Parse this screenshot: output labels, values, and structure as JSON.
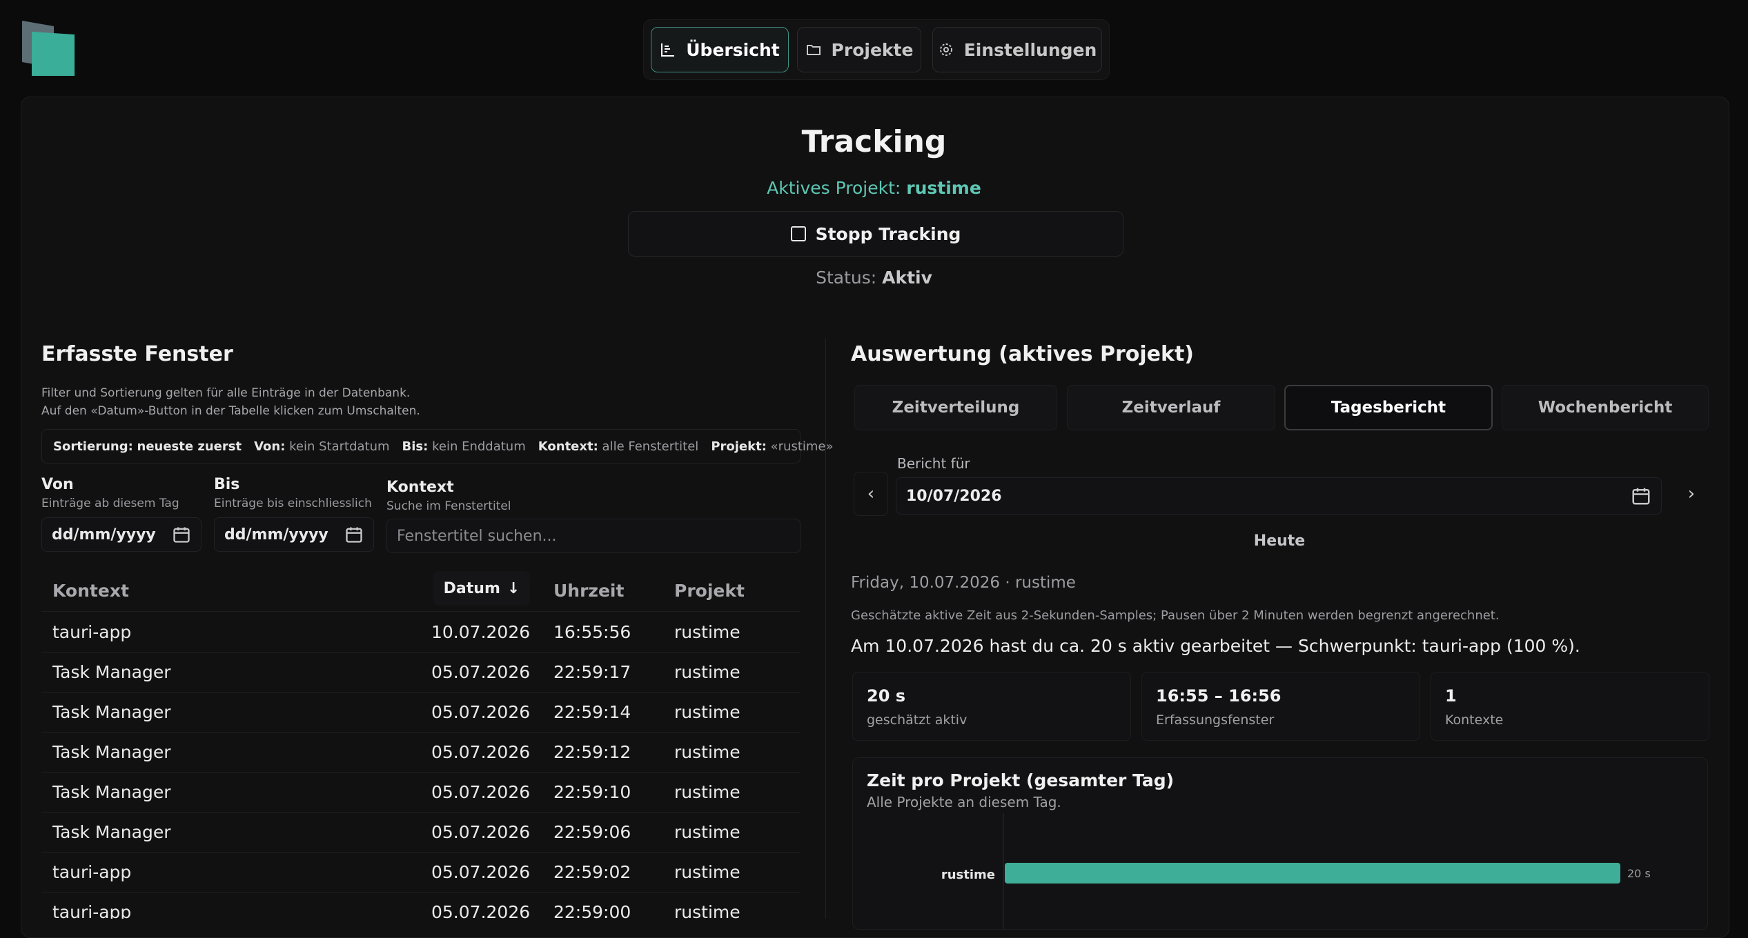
{
  "nav": {
    "overview": "Übersicht",
    "projects": "Projekte",
    "settings": "Einstellungen"
  },
  "header": {
    "title": "Tracking",
    "active_project_label": "Aktives Projekt:",
    "active_project_name": "rustime",
    "stop_button": "Stopp Tracking",
    "status_label": "Status:",
    "status_value": "Aktiv"
  },
  "windows": {
    "title": "Erfasste Fenster",
    "hint1": "Filter und Sortierung gelten für alle Einträge in der Datenbank.",
    "hint2": "Auf den «Datum»-Button in der Tabelle klicken zum Umschalten.",
    "filterbar": {
      "sort_label": "Sortierung:",
      "sort_value": "neueste zuerst",
      "from_label": "Von:",
      "from_value": "kein Startdatum",
      "to_label": "Bis:",
      "to_value": "kein Enddatum",
      "context_label": "Kontext:",
      "context_value": "alle Fenstertitel",
      "project_label": "Projekt:",
      "project_value": "«rustime»"
    },
    "from": {
      "label": "Von",
      "sub": "Einträge ab diesem Tag",
      "value": "dd/mm/yyyy"
    },
    "to": {
      "label": "Bis",
      "sub": "Einträge bis einschliesslich",
      "value": "dd/mm/yyyy"
    },
    "context": {
      "label": "Kontext",
      "sub": "Suche im Fenstertitel",
      "placeholder": "Fenstertitel suchen..."
    },
    "columns": {
      "context": "Kontext",
      "date": "Datum",
      "time": "Uhrzeit",
      "project": "Projekt"
    },
    "rows": [
      {
        "context": "tauri-app",
        "date": "10.07.2026",
        "time": "16:55:56",
        "project": "rustime"
      },
      {
        "context": "Task Manager",
        "date": "05.07.2026",
        "time": "22:59:17",
        "project": "rustime"
      },
      {
        "context": "Task Manager",
        "date": "05.07.2026",
        "time": "22:59:14",
        "project": "rustime"
      },
      {
        "context": "Task Manager",
        "date": "05.07.2026",
        "time": "22:59:12",
        "project": "rustime"
      },
      {
        "context": "Task Manager",
        "date": "05.07.2026",
        "time": "22:59:10",
        "project": "rustime"
      },
      {
        "context": "Task Manager",
        "date": "05.07.2026",
        "time": "22:59:06",
        "project": "rustime"
      },
      {
        "context": "tauri-app",
        "date": "05.07.2026",
        "time": "22:59:02",
        "project": "rustime"
      },
      {
        "context": "tauri-app",
        "date": "05.07.2026",
        "time": "22:59:00",
        "project": "rustime"
      }
    ]
  },
  "analysis": {
    "title": "Auswertung (aktives Projekt)",
    "tabs": [
      "Zeitverteilung",
      "Zeitverlauf",
      "Tagesbericht",
      "Wochenbericht"
    ],
    "active_tab": "Tagesbericht",
    "report_for_label": "Bericht für",
    "report_date": "10/07/2026",
    "today_button": "Heute",
    "day_line": "Friday, 10.07.2026 · rustime",
    "note": "Geschätzte aktive Zeit aus 2-Sekunden-Samples; Pausen über 2 Minuten werden begrenzt angerechnet.",
    "summary": "Am 10.07.2026 hast du ca. 20 s aktiv gearbeitet — Schwerpunkt: tauri-app (100 %).",
    "stats": [
      {
        "value": "20 s",
        "label": "geschätzt aktiv"
      },
      {
        "value": "16:55 – 16:56",
        "label": "Erfassungsfenster"
      },
      {
        "value": "1",
        "label": "Kontexte"
      }
    ],
    "chart_title": "Zeit pro Projekt (gesamter Tag)",
    "chart_subtitle": "Alle Projekte an diesem Tag."
  },
  "chart_data": {
    "type": "bar",
    "orientation": "horizontal",
    "categories": [
      "rustime"
    ],
    "values": [
      20
    ],
    "value_labels": [
      "20 s"
    ],
    "title": "Zeit pro Projekt (gesamter Tag)",
    "subtitle": "Alle Projekte an diesem Tag.",
    "color": "#3fae98",
    "xlim": [
      0,
      20
    ]
  },
  "colors": {
    "accent": "#3fae98",
    "accent_text": "#5ec7b3",
    "background": "#0b0b0c"
  }
}
